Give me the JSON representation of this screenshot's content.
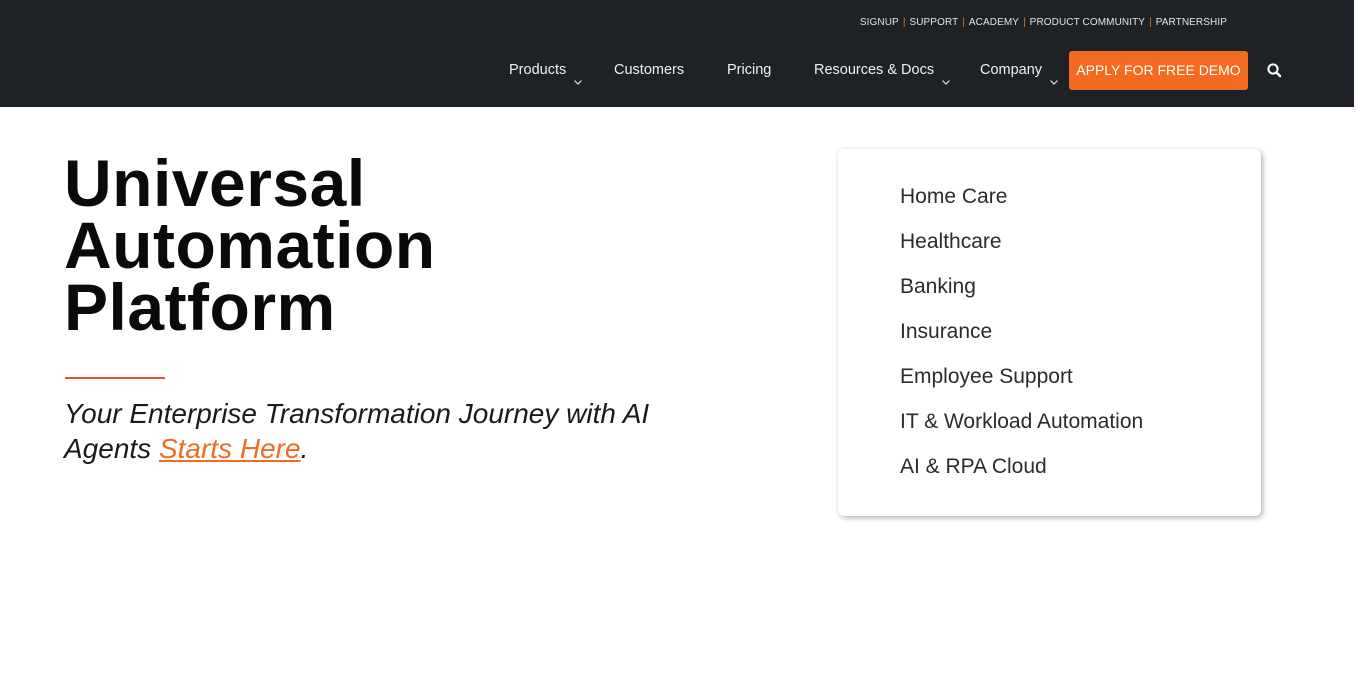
{
  "top_links": [
    "SIGNUP",
    "SUPPORT",
    "ACADEMY",
    "PRODUCT COMMUNITY",
    "PARTNERSHIP"
  ],
  "nav": {
    "products": "Products",
    "customers": "Customers",
    "pricing": "Pricing",
    "resources": "Resources & Docs",
    "company": "Company",
    "demo_label": "APPLY FOR FREE DEMO"
  },
  "hero": {
    "title_lines": [
      "Universal",
      "Automation",
      "Platform"
    ],
    "subtitle_text": "Your Enterprise Transformation Journey with AI Agents ",
    "subtitle_link": "Starts Here",
    "subtitle_end": "."
  },
  "industries": [
    "Home Care",
    "Healthcare",
    "Banking",
    "Insurance",
    "Employee Support",
    "IT & Workload Automation",
    "AI & RPA Cloud"
  ],
  "colors": {
    "header_bg": "#1e2126",
    "accent": "#f26b21",
    "divider": "#e3503a"
  },
  "icons": {
    "search": "search-icon",
    "dropdown": "chevron-down-icon"
  }
}
